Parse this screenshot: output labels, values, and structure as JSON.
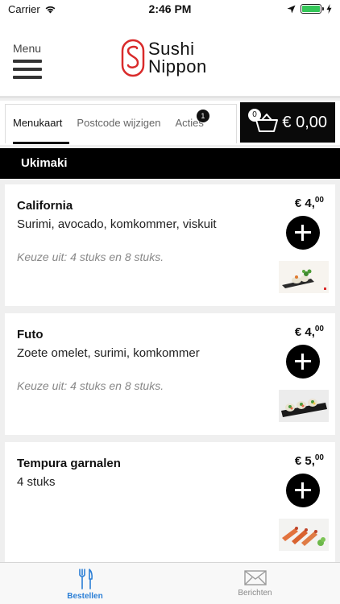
{
  "status_bar": {
    "carrier": "Carrier",
    "time": "2:46 PM",
    "battery_level": 1.0
  },
  "header": {
    "menu_label": "Menu",
    "logo_line1": "Sushi",
    "logo_line2": "Nippon",
    "brand_color": "#d92b2b"
  },
  "tabs": [
    {
      "label": "Menukaart"
    },
    {
      "label": "Postcode wijzigen"
    },
    {
      "label": "Acties",
      "badge": "1"
    }
  ],
  "cart": {
    "count": "0",
    "total": "€ 0,00"
  },
  "section": {
    "title": "Ukimaki"
  },
  "products": [
    {
      "name": "California",
      "description": "Surimi, avocado, komkommer, viskuit",
      "choice": "Keuze uit: 4 stuks en 8 stuks.",
      "price_main": "€ 4,",
      "price_cents": "00",
      "image_icon": "california-roll-image"
    },
    {
      "name": "Futo",
      "description": "Zoete omelet, surimi, komkommer",
      "choice": "Keuze uit: 4 stuks en 8 stuks.",
      "price_main": "€ 4,",
      "price_cents": "00",
      "image_icon": "futo-roll-image"
    },
    {
      "name": "Tempura garnalen",
      "description": "4 stuks",
      "choice": "",
      "price_main": "€ 5,",
      "price_cents": "00",
      "image_icon": "tempura-shrimp-image"
    }
  ],
  "tabbar": [
    {
      "label": "Bestellen",
      "icon": "cutlery-icon",
      "active": true
    },
    {
      "label": "Berichten",
      "icon": "envelope-icon",
      "active": false
    }
  ],
  "colors": {
    "accent": "#2b7fd6",
    "dark": "#000000"
  }
}
